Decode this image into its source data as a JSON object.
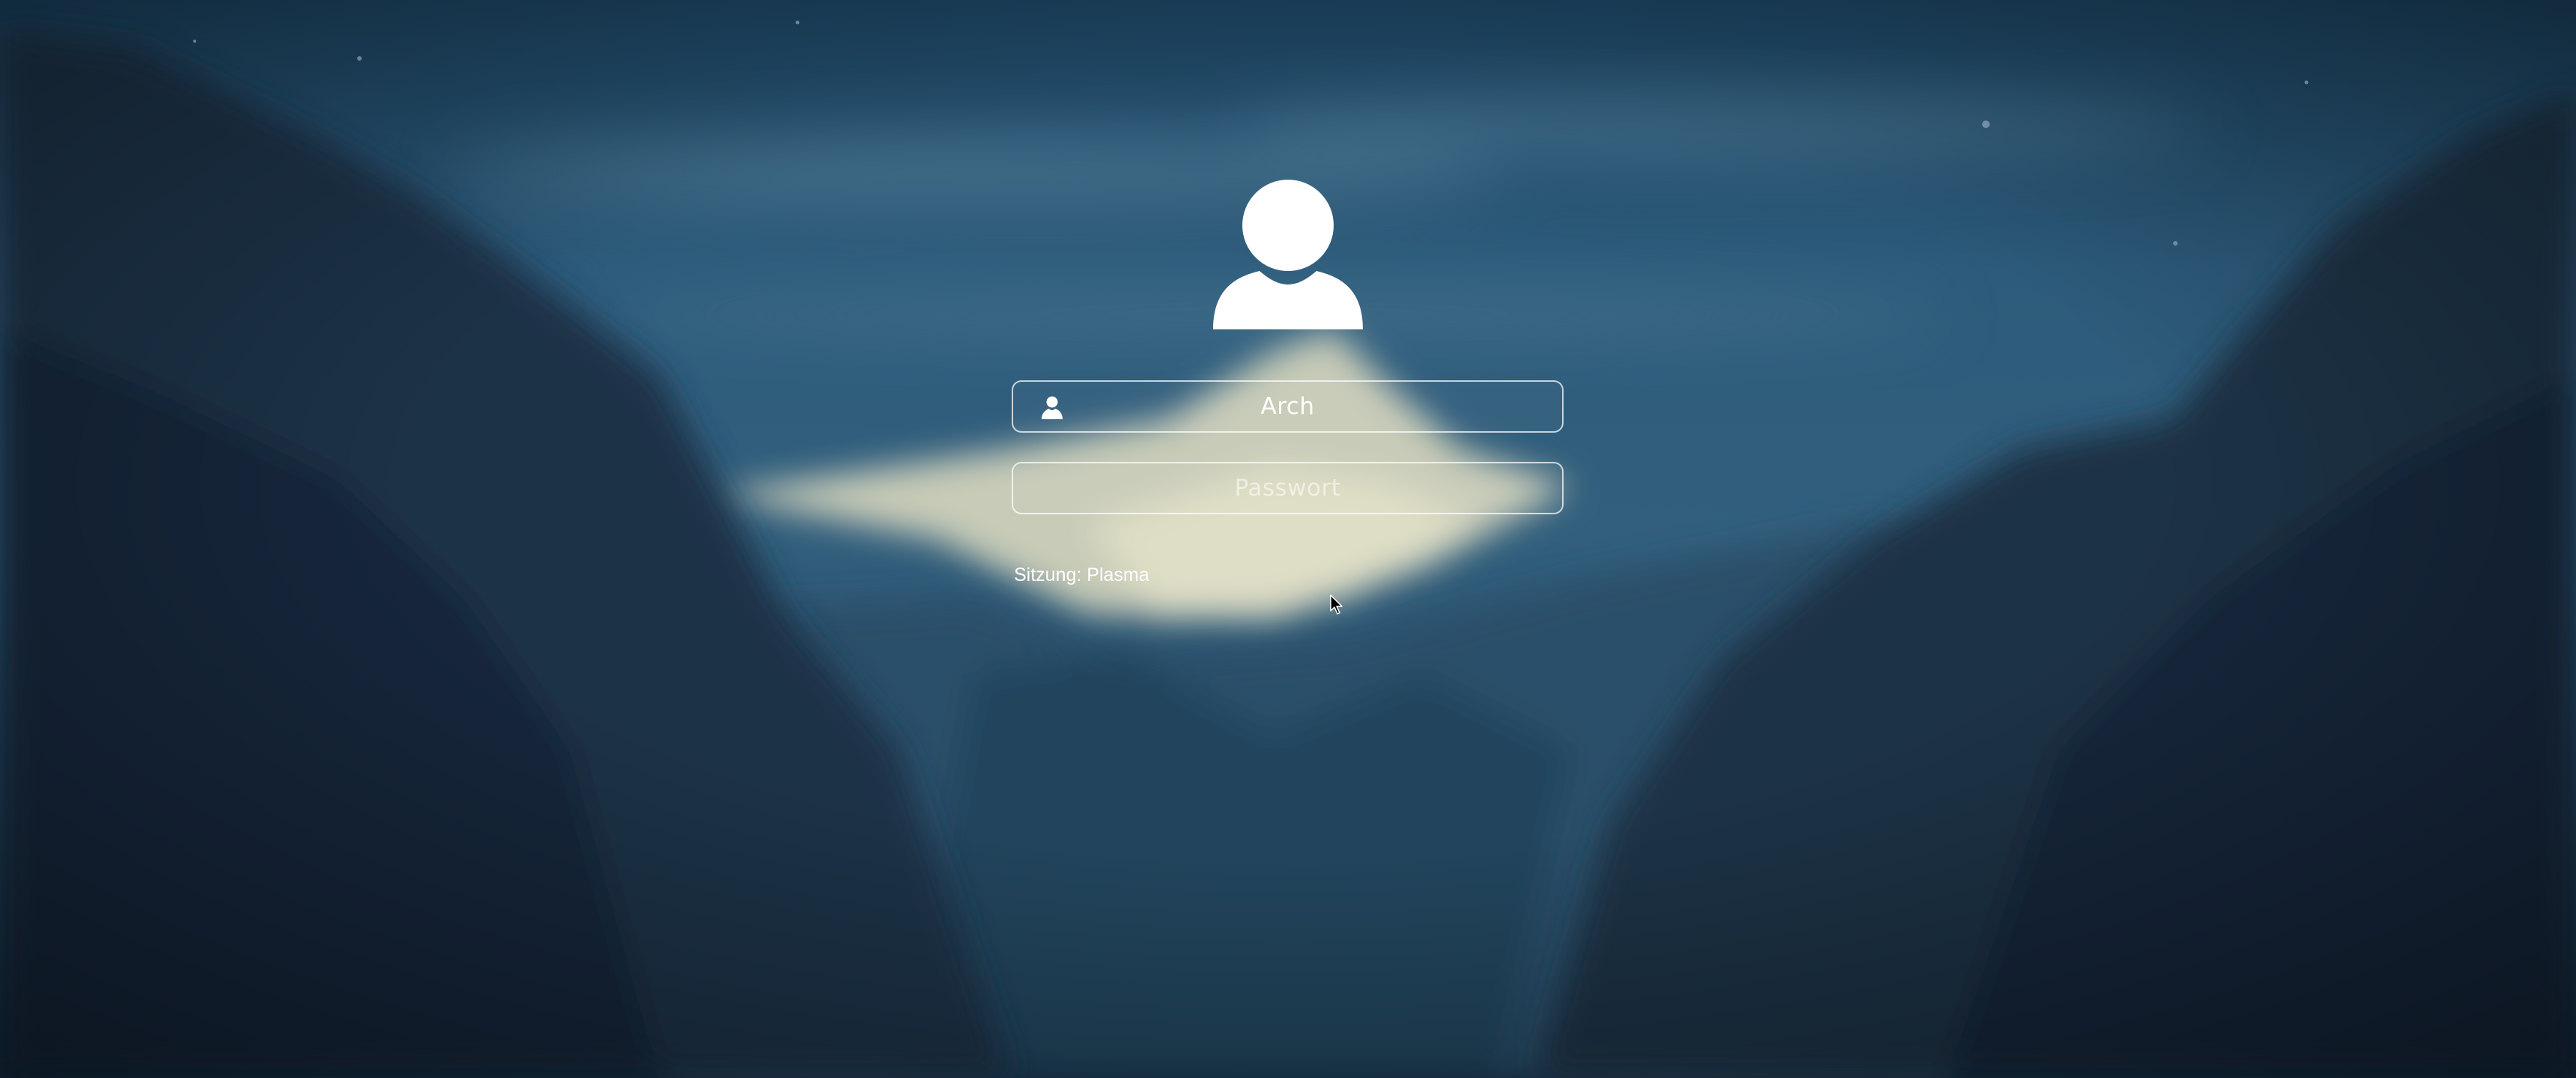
{
  "login": {
    "username": "Arch",
    "password_placeholder": "Passwort",
    "session_label": "Sitzung:",
    "session_value": "Plasma"
  },
  "icons": {
    "avatar": "user-avatar-icon",
    "username_field": "user-icon",
    "pointer": "mouse-cursor-icon"
  },
  "colors": {
    "field_border": "#ffffff",
    "text": "#ffffff",
    "background_sky": "#2f5a7a",
    "background_dark": "#0e1f30"
  }
}
